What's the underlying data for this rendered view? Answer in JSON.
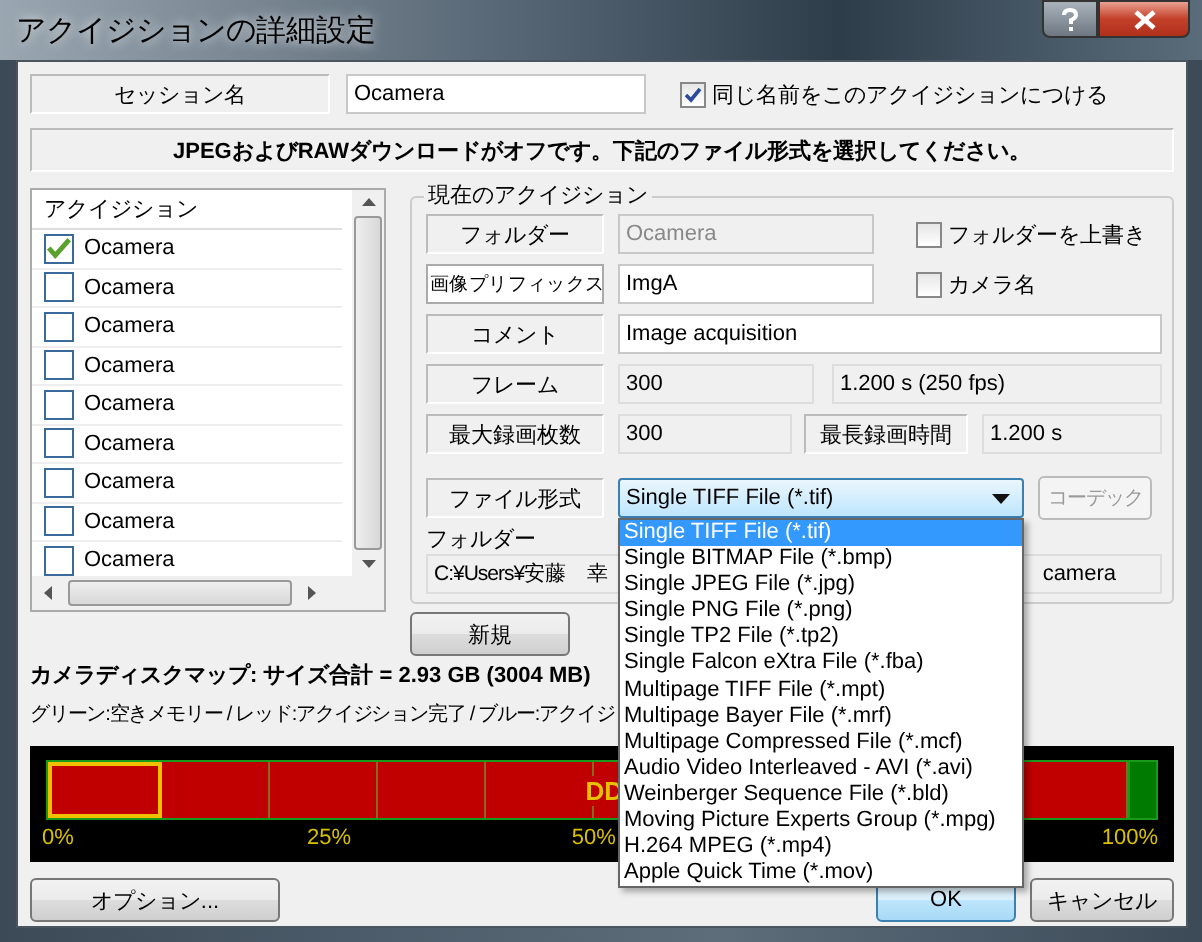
{
  "window": {
    "title": "アクイジションの詳細設定"
  },
  "session": {
    "label": "セッション名",
    "value": "Ocamera",
    "same_name": {
      "label": "同じ名前をこのアクイジションにつける",
      "checked": true
    }
  },
  "notice": "JPEGおよびRAWダウンロードがオフです。下記のファイル形式を選択してください。",
  "acquisition_list": {
    "header": "アクイジション",
    "items": [
      {
        "label": "Ocamera",
        "checked": true
      },
      {
        "label": "Ocamera",
        "checked": false
      },
      {
        "label": "Ocamera",
        "checked": false
      },
      {
        "label": "Ocamera",
        "checked": false
      },
      {
        "label": "Ocamera",
        "checked": false
      },
      {
        "label": "Ocamera",
        "checked": false
      },
      {
        "label": "Ocamera",
        "checked": false
      },
      {
        "label": "Ocamera",
        "checked": false
      },
      {
        "label": "Ocamera",
        "checked": false
      }
    ]
  },
  "current": {
    "title": "現在のアクイジション",
    "folder": {
      "label": "フォルダー",
      "value": "Ocamera",
      "disabled": true
    },
    "overwrite": {
      "label": "フォルダーを上書き",
      "checked": false
    },
    "prefix": {
      "label": "画像プリフィックス",
      "value": "ImgA"
    },
    "camera_name": {
      "label": "カメラ名",
      "checked": false
    },
    "comment": {
      "label": "コメント",
      "value": "Image acquisition"
    },
    "frames": {
      "label": "フレーム",
      "value": "300",
      "duration": "1.200 s (250 fps)"
    },
    "max_frames": {
      "label": "最大録画枚数",
      "value": "300"
    },
    "max_time": {
      "label": "最長録画時間",
      "value": "1.200 s"
    },
    "file_format": {
      "label": "ファイル形式",
      "value": "Single TIFF File (*.tif)",
      "expanded": true,
      "options": [
        {
          "label": "Single TIFF File (*.tif)",
          "selected": true
        },
        {
          "label": "Single BITMAP File (*.bmp)",
          "selected": false
        },
        {
          "label": "Single JPEG File (*.jpg)",
          "selected": false
        },
        {
          "label": "Single PNG File (*.png)",
          "selected": false
        },
        {
          "label": "Single TP2 File (*.tp2)",
          "selected": false
        },
        {
          "label": "Single Falcon eXtra File (*.fba)",
          "selected": false
        },
        {
          "label": "Multipage TIFF File (*.mpt)",
          "selected": false
        },
        {
          "label": "Multipage Bayer File (*.mrf)",
          "selected": false
        },
        {
          "label": "Multipage Compressed File (*.mcf)",
          "selected": false
        },
        {
          "label": "Audio Video Interleaved - AVI (*.avi)",
          "selected": false
        },
        {
          "label": "Weinberger Sequence File (*.bld)",
          "selected": false
        },
        {
          "label": "Moving Picture Experts Group (*.mpg)",
          "selected": false
        },
        {
          "label": "H.264 MPEG (*.mp4)",
          "selected": false
        },
        {
          "label": "Apple Quick Time (*.mov)",
          "selected": false
        }
      ]
    },
    "codec_button": {
      "label": "コーデック",
      "disabled": true
    },
    "path": {
      "label": "フォルダー",
      "start": "C:¥Users¥安藤　幸",
      "end": "camera"
    }
  },
  "new_button": "新規",
  "disk_map": {
    "summary": "カメラディスクマップ: サイズ合計 = 2.93 GB (3004 MB)",
    "legend": "グリーン:空きメモリー / レッド:アクイジション完了 / ブルー:アクイジ",
    "bar_label": "DD",
    "segments": [
      {
        "kind": "used",
        "selected": true
      },
      {
        "kind": "used",
        "selected": false
      },
      {
        "kind": "used",
        "selected": false
      },
      {
        "kind": "used",
        "selected": false
      },
      {
        "kind": "used",
        "selected": false
      },
      {
        "kind": "used",
        "selected": false
      },
      {
        "kind": "wide",
        "selected": false
      },
      {
        "kind": "free",
        "selected": false
      }
    ],
    "ticks": [
      "0%",
      "25%",
      "50%",
      "100%"
    ]
  },
  "buttons": {
    "options": "オプション...",
    "ok": "OK",
    "cancel": "キャンセル"
  }
}
